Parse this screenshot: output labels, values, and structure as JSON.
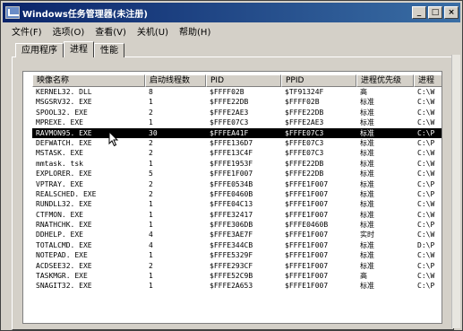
{
  "window": {
    "title": "Windows任务管理器(未注册)",
    "buttons": {
      "minimize": "_",
      "maximize": "□",
      "close": "×"
    }
  },
  "menu": [
    "文件(F)",
    "选项(O)",
    "查看(V)",
    "关机(U)",
    "帮助(H)"
  ],
  "tabs": [
    {
      "label": "应用程序",
      "active": false
    },
    {
      "label": "进程",
      "active": true
    },
    {
      "label": "性能",
      "active": false
    }
  ],
  "columns": [
    "映像名称",
    "启动线程数",
    "PID",
    "PPID",
    "进程优先级",
    "进程"
  ],
  "rows": [
    [
      "KERNEL32. DLL",
      "8",
      "$FFFF02B",
      "$TF91324F",
      "高",
      "C:\\W"
    ],
    [
      "MSGSRV32. EXE",
      "1",
      "$FFFE22DB",
      "$FFFF02B",
      "标准",
      "C:\\W"
    ],
    [
      "SPOOL32. EXE",
      "2",
      "$FFFE2AE3",
      "$FFFE22DB",
      "标准",
      "C:\\W"
    ],
    [
      "MPREXE. EXE",
      "1",
      "$FFFE07C3",
      "$FFFE2AE3",
      "标准",
      "C:\\W"
    ],
    [
      "RAVMON95. EXE",
      "30",
      "$FFFEA41F",
      "$FFFE07C3",
      "标准",
      "C:\\P"
    ],
    [
      "DEFWATCH. EXE",
      "2",
      "$FFFE136D7",
      "$FFFE07C3",
      "标准",
      "C:\\P"
    ],
    [
      "MSTASK. EXE",
      "2",
      "$FFFE13C4F",
      "$FFFE07C3",
      "标准",
      "C:\\W"
    ],
    [
      "mmtask. tsk",
      "1",
      "$FFFE1953F",
      "$FFFE22DB",
      "标准",
      "C:\\W"
    ],
    [
      "EXPLORER. EXE",
      "5",
      "$FFFE1F007",
      "$FFFE22DB",
      "标准",
      "C:\\W"
    ],
    [
      "VPTRAY. EXE",
      "2",
      "$FFFE0534B",
      "$FFFE1F007",
      "标准",
      "C:\\P"
    ],
    [
      "REALSCHED. EXE",
      "2",
      "$FFFE0460B",
      "$FFFE1F007",
      "标准",
      "C:\\P"
    ],
    [
      "RUNDLL32. EXE",
      "1",
      "$FFFE04C13",
      "$FFFE1F007",
      "标准",
      "C:\\W"
    ],
    [
      "CTFMON. EXE",
      "1",
      "$FFFE32417",
      "$FFFE1F007",
      "标准",
      "C:\\W"
    ],
    [
      "RNATHCHK. EXE",
      "1",
      "$FFFE306DB",
      "$FFFE0460B",
      "标准",
      "C:\\P"
    ],
    [
      "DDHELP. EXE",
      "4",
      "$FFFE3AE7F",
      "$FFFE1F007",
      "实时",
      "C:\\W"
    ],
    [
      "TOTALCMD. EXE",
      "4",
      "$FFFE344CB",
      "$FFFE1F007",
      "标准",
      "D:\\P"
    ],
    [
      "NOTEPAD. EXE",
      "1",
      "$FFFE5329F",
      "$FFFE1F007",
      "标准",
      "C:\\W"
    ],
    [
      "ACDSEE32. EXE",
      "2",
      "$FFFE293CF",
      "$FFFE1F007",
      "标准",
      "C:\\P"
    ],
    [
      "TASKMGR. EXE",
      "1",
      "$FFFE52C9B",
      "$FFFE1F007",
      "高",
      "C:\\W"
    ],
    [
      "SNAGIT32. EXE",
      "1",
      "$FFFE2A653",
      "$FFFE1F007",
      "标准",
      "C:\\P"
    ]
  ],
  "selected_row": 4,
  "colors": {
    "titlebar_start": "#0a246a",
    "titlebar_end": "#3a6ea5",
    "chrome": "#d4d0c8",
    "selection": "#000000"
  },
  "icons": [
    "app-icon",
    "cursor-arrow-icon"
  ]
}
